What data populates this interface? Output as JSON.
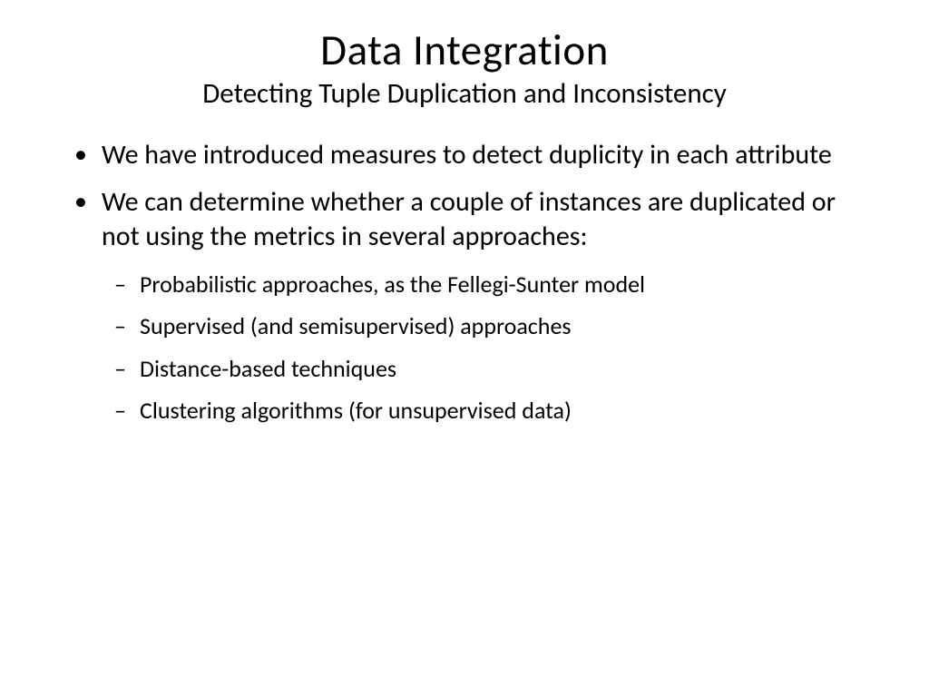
{
  "title": "Data Integration",
  "subtitle": "Detecting Tuple Duplication and Inconsistency",
  "bullets": [
    {
      "text": "We have introduced measures to detect duplicity in each attribute",
      "subs": []
    },
    {
      "text": "We can determine whether a couple of instances are duplicated or not using the metrics in several approaches:",
      "subs": [
        "Probabilistic approaches, as the Fellegi-Sunter model",
        "Supervised (and semisupervised) approaches",
        "Distance-based techniques",
        "Clustering algorithms (for unsupervised data)"
      ]
    }
  ]
}
